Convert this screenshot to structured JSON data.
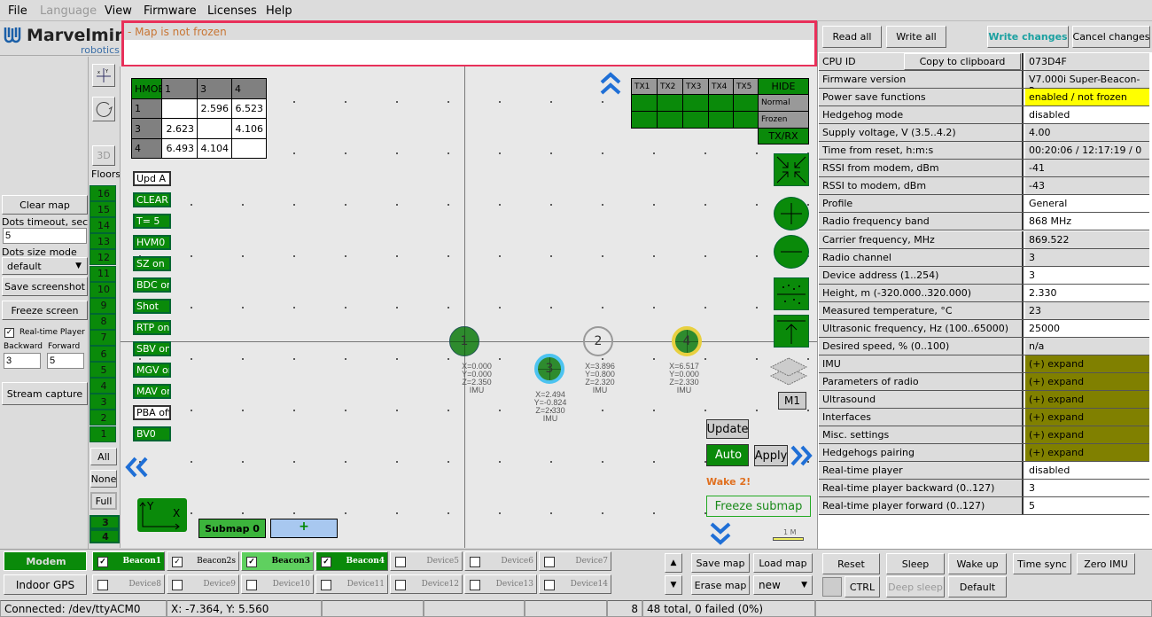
{
  "menu": [
    "File",
    "Language",
    "View",
    "Firmware",
    "Licenses",
    "Help"
  ],
  "logo": {
    "name": "Marvelmind",
    "sub": "robotics"
  },
  "message": "- Map is not frozen",
  "left": {
    "clear_map": "Clear map",
    "dots_timeout_label": "Dots timeout, sec",
    "dots_timeout": "5",
    "dots_size_label": "Dots size mode",
    "dots_size": "default",
    "save_screenshot": "Save screenshot",
    "freeze_screen": "Freeze screen",
    "realtime_player": "Real-time Player",
    "realtime_checked": true,
    "backward_label": "Backward",
    "forward_label": "Forward",
    "backward": "3",
    "forward": "5",
    "stream_capture": "Stream capture"
  },
  "floors": {
    "btn3d": "3D",
    "label": "Floors",
    "items": [
      "16",
      "15",
      "14",
      "13",
      "12",
      "11",
      "10",
      "9",
      "8",
      "7",
      "6",
      "5",
      "4",
      "3",
      "2",
      "1"
    ],
    "all": "All",
    "none": "None",
    "full": "Full",
    "extra": [
      "3",
      "4"
    ]
  },
  "distance_table": {
    "header": [
      "HMOB",
      "1",
      "3",
      "4"
    ],
    "rows": [
      [
        "1",
        "",
        "2.596",
        "6.523"
      ],
      [
        "3",
        "2.623",
        "",
        "4.106"
      ],
      [
        "4",
        "6.493",
        "4.104",
        ""
      ]
    ]
  },
  "map_buttons": [
    {
      "label": "Upd A",
      "on": false
    },
    {
      "label": "CLEAR",
      "on": true
    },
    {
      "label": "T= 5",
      "on": true
    },
    {
      "label": "HVM0",
      "on": true
    },
    {
      "label": "SZ on",
      "on": true
    },
    {
      "label": "BDC on",
      "on": true
    },
    {
      "label": "Shot",
      "on": true
    },
    {
      "label": "RTP on",
      "on": true
    },
    {
      "label": "SBV on",
      "on": true
    },
    {
      "label": "MGV on",
      "on": true
    },
    {
      "label": "MAV on",
      "on": true
    },
    {
      "label": "PBA off",
      "on": false
    },
    {
      "label": "BV0",
      "on": true
    }
  ],
  "tx_table": {
    "header": [
      "TX1",
      "TX2",
      "TX3",
      "TX4",
      "TX5"
    ],
    "hide": "HIDE",
    "normal": "Normal",
    "frozen": "Frozen",
    "txrx": "TX/RX"
  },
  "beacons": [
    {
      "id": "1",
      "ring": "#2e8b2e",
      "coords": [
        "X=0.000",
        "Y=0.000",
        "Z=2.350",
        "IMU"
      ]
    },
    {
      "id": "3",
      "ring": "#4cc3f0",
      "coords": [
        "X=2.494",
        "Y=-0.824",
        "Z=2.330",
        "IMU"
      ]
    },
    {
      "id": "2",
      "ring": "none",
      "coords": [
        "X=3.896",
        "Y=0.800",
        "Z=2.320",
        "IMU"
      ]
    },
    {
      "id": "4",
      "ring": "#e8d040",
      "coords": [
        "X=6.517",
        "Y=0.000",
        "Z=2.330",
        "IMU"
      ]
    }
  ],
  "map_controls": {
    "m1": "M1",
    "update": "Update",
    "auto": "Auto",
    "apply": "Apply",
    "wake": "Wake 2!",
    "freeze_submap": "Freeze submap",
    "scale": "1 M",
    "submap": "Submap 0",
    "add_submap": "+",
    "axis_y": "Y",
    "axis_x": "X"
  },
  "right": {
    "read_all": "Read all",
    "write_all": "Write all",
    "write_changes": "Write changes",
    "cancel_changes": "Cancel changes",
    "copy": "Copy to clipboard",
    "rows": [
      {
        "label": "CPU ID",
        "value": "073D4F",
        "bg": "#dcdcdc"
      },
      {
        "label": "Firmware version",
        "value": "V7.000i Super-Beacon-2",
        "bg": "#dcdcdc"
      },
      {
        "label": "Power save functions",
        "value": "enabled / not frozen",
        "bg": "#ffff00"
      },
      {
        "label": "Hedgehog mode",
        "value": "disabled",
        "bg": "#ffffff"
      },
      {
        "label": "Supply voltage, V (3.5..4.2)",
        "value": "4.00",
        "bg": "#dcdcdc"
      },
      {
        "label": "Time from reset, h:m:s",
        "value": "00:20:06 / 12:17:19 / 0",
        "bg": "#dcdcdc"
      },
      {
        "label": "RSSI from modem, dBm",
        "value": "-41",
        "bg": "#dcdcdc"
      },
      {
        "label": "RSSI to modem, dBm",
        "value": "-43",
        "bg": "#dcdcdc"
      },
      {
        "label": "Profile",
        "value": "General",
        "bg": "#ffffff"
      },
      {
        "label": "Radio frequency band",
        "value": "868 MHz",
        "bg": "#ffffff"
      },
      {
        "label": "Carrier frequency, MHz",
        "value": "869.522",
        "bg": "#dcdcdc"
      },
      {
        "label": "Radio channel",
        "value": "3",
        "bg": "#dcdcdc"
      },
      {
        "label": "Device address (1..254)",
        "value": "3",
        "bg": "#ffffff"
      },
      {
        "label": "Height, m (-320.000..320.000)",
        "value": "2.330",
        "bg": "#ffffff"
      },
      {
        "label": "Measured temperature, °C",
        "value": "23",
        "bg": "#dcdcdc"
      },
      {
        "label": "Ultrasonic frequency, Hz (100..65000)",
        "value": "25000",
        "bg": "#ffffff"
      },
      {
        "label": "Desired speed, % (0..100)",
        "value": "n/a",
        "bg": "#dcdcdc"
      },
      {
        "label": "IMU",
        "value": "(+) expand",
        "bg": "#808000"
      },
      {
        "label": "Parameters of radio",
        "value": "(+) expand",
        "bg": "#808000"
      },
      {
        "label": "Ultrasound",
        "value": "(+) expand",
        "bg": "#808000"
      },
      {
        "label": "Interfaces",
        "value": "(+) expand",
        "bg": "#808000"
      },
      {
        "label": "Misc. settings",
        "value": "(+) expand",
        "bg": "#808000"
      },
      {
        "label": "Hedgehogs pairing",
        "value": "(+) expand",
        "bg": "#808000"
      },
      {
        "label": "Real-time player",
        "value": "disabled",
        "bg": "#ffffff"
      },
      {
        "label": "Real-time player backward (0..127)",
        "value": "3",
        "bg": "#ffffff"
      },
      {
        "label": "Real-time player forward (0..127)",
        "value": "5",
        "bg": "#ffffff"
      }
    ],
    "reset": "Reset",
    "sleep": "Sleep",
    "wake_up": "Wake up",
    "time_sync": "Time sync",
    "zero_imu": "Zero IMU",
    "ctrl": "CTRL",
    "deep_sleep": "Deep sleep",
    "default": "Default"
  },
  "bottom": {
    "modem": "Modem",
    "indoor_gps": "Indoor GPS",
    "save_map": "Save map",
    "load_map": "Load map",
    "erase_map": "Erase map",
    "map_select": "new",
    "devices": [
      {
        "label": "Beacon1",
        "checked": true,
        "state": "active"
      },
      {
        "label": "Beacon2s",
        "checked": true,
        "state": "normal"
      },
      {
        "label": "Beacon3",
        "checked": true,
        "state": "selected"
      },
      {
        "label": "Beacon4",
        "checked": true,
        "state": "active"
      },
      {
        "label": "Device5",
        "checked": false,
        "state": "off"
      },
      {
        "label": "Device6",
        "checked": false,
        "state": "off"
      },
      {
        "label": "Device7",
        "checked": false,
        "state": "off"
      },
      {
        "label": "Device8",
        "checked": false,
        "state": "off"
      },
      {
        "label": "Device9",
        "checked": false,
        "state": "off"
      },
      {
        "label": "Device10",
        "checked": false,
        "state": "off"
      },
      {
        "label": "Device11",
        "checked": false,
        "state": "off"
      },
      {
        "label": "Device12",
        "checked": false,
        "state": "off"
      },
      {
        "label": "Device13",
        "checked": false,
        "state": "off"
      },
      {
        "label": "Device14",
        "checked": false,
        "state": "off"
      }
    ]
  },
  "status": {
    "connection": "Connected: /dev/ttyACM0",
    "cursor": "X: -7.364, Y: 5.560",
    "count": "8",
    "packets": "48 total, 0 failed (0%)"
  }
}
